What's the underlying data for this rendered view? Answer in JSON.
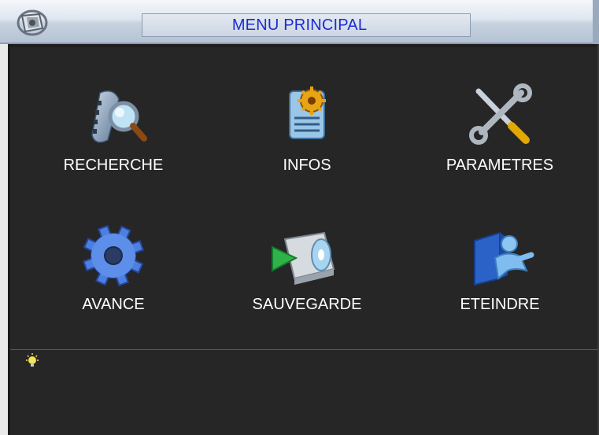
{
  "window": {
    "title": "MENU PRINCIPAL"
  },
  "menu": {
    "items": [
      {
        "label": "RECHERCHE",
        "icon": "search-film-icon"
      },
      {
        "label": "INFOS",
        "icon": "info-document-gear-icon"
      },
      {
        "label": "PARAMETRES",
        "icon": "tools-icon"
      },
      {
        "label": "AVANCE",
        "icon": "gear-icon"
      },
      {
        "label": "SAUVEGARDE",
        "icon": "backup-icon"
      },
      {
        "label": "ETEINDRE",
        "icon": "logout-icon"
      }
    ]
  },
  "status": {
    "icon": "lightbulb-icon",
    "text": ""
  },
  "colors": {
    "background": "#262626",
    "title_text": "#1c2bd2",
    "label_text": "#ffffff"
  }
}
